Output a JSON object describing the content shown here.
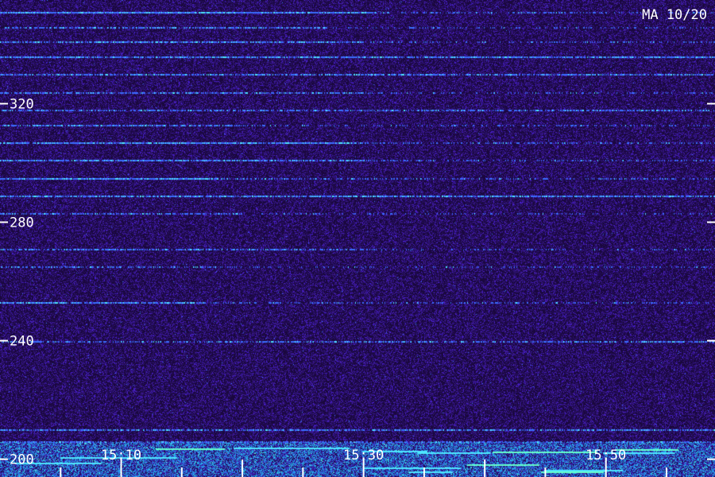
{
  "station_label": "MA 10/20",
  "colors": {
    "background": "#1c0840",
    "noise_purple": "#4a1fa0",
    "line_blue": "#3a6cff",
    "line_cyan": "#4ee6ff",
    "line_green": "#66ffcc",
    "text": "#ffffff"
  },
  "chart_data": {
    "type": "heatmap",
    "y_ticks": [
      320,
      280,
      240,
      200
    ],
    "x_ticks": [
      "15:10",
      "15:30",
      "15:50"
    ],
    "ylim": [
      194,
      355
    ],
    "xlim": [
      "15:00",
      "15:59"
    ],
    "ylabel": "",
    "xlabel": "",
    "emission_lines": [
      {
        "y": 351,
        "strength": 0.95,
        "fade_time": "15:31"
      },
      {
        "y": 346,
        "strength": 0.6,
        "fade_time": "15:27"
      },
      {
        "y": 341,
        "strength": 0.75,
        "fade_time": "15:30"
      },
      {
        "y": 336,
        "strength": 0.8,
        "fade_time": "15:59"
      },
      {
        "y": 330,
        "strength": 0.7,
        "fade_time": "15:59"
      },
      {
        "y": 324,
        "strength": 0.65,
        "fade_time": "15:30"
      },
      {
        "y": 318,
        "strength": 0.6,
        "fade_time": "15:59"
      },
      {
        "y": 313,
        "strength": 0.7,
        "fade_time": "15:20"
      },
      {
        "y": 307,
        "strength": 0.9,
        "fade_time": "15:30"
      },
      {
        "y": 301,
        "strength": 0.8,
        "fade_time": "15:30"
      },
      {
        "y": 295,
        "strength": 0.95,
        "fade_time": "15:18"
      },
      {
        "y": 289,
        "strength": 0.8,
        "fade_time": "15:59"
      },
      {
        "y": 283,
        "strength": 0.55,
        "fade_time": "15:20"
      },
      {
        "y": 271,
        "strength": 0.6,
        "fade_time": "15:30"
      },
      {
        "y": 265,
        "strength": 0.5,
        "fade_time": "15:18"
      },
      {
        "y": 253,
        "strength": 0.85,
        "fade_time": "15:17"
      },
      {
        "y": 240,
        "strength": 0.55,
        "fade_time": "15:59"
      },
      {
        "y": 210,
        "strength": 0.7,
        "fade_time": "15:59"
      },
      {
        "y": 206,
        "strength": 0.55,
        "fade_time": "15:59"
      }
    ],
    "broadband_band": [
      194,
      206
    ]
  }
}
